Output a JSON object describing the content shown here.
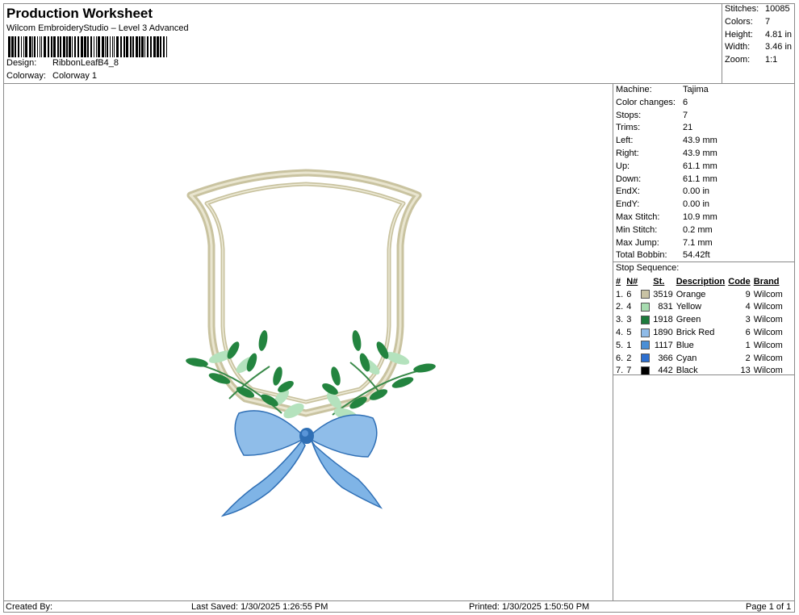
{
  "header": {
    "title": "Production Worksheet",
    "subtitle": "Wilcom EmbroideryStudio – Level 3 Advanced",
    "design_label": "Design:",
    "design_value": "RibbonLeafB4_8",
    "colorway_label": "Colorway:",
    "colorway_value": "Colorway 1"
  },
  "stats": [
    {
      "label": "Stitches:",
      "value": "10085"
    },
    {
      "label": "Colors:",
      "value": "7"
    },
    {
      "label": "Height:",
      "value": "4.81 in"
    },
    {
      "label": "Width:",
      "value": "3.46 in"
    },
    {
      "label": "Zoom:",
      "value": "1:1"
    }
  ],
  "machine": [
    {
      "label": "Machine:",
      "value": "Tajima"
    },
    {
      "label": "Color changes:",
      "value": "6"
    },
    {
      "label": "Stops:",
      "value": "7"
    },
    {
      "label": "Trims:",
      "value": "21"
    },
    {
      "label": "Left:",
      "value": "43.9 mm"
    },
    {
      "label": "Right:",
      "value": "43.9 mm"
    },
    {
      "label": "Up:",
      "value": "61.1 mm"
    },
    {
      "label": "Down:",
      "value": "61.1 mm"
    },
    {
      "label": "EndX:",
      "value": "0.00 in"
    },
    {
      "label": "EndY:",
      "value": "0.00 in"
    },
    {
      "label": "Max Stitch:",
      "value": "10.9 mm"
    },
    {
      "label": "Min Stitch:",
      "value": "0.2 mm"
    },
    {
      "label": "Max Jump:",
      "value": "7.1 mm"
    },
    {
      "label": "Total Bobbin:",
      "value": "54.42ft"
    }
  ],
  "stop_sequence": {
    "title": "Stop Sequence:",
    "columns": [
      "#",
      "N#",
      "St.",
      "Description",
      "Code",
      "Brand"
    ],
    "rows": [
      {
        "idx": "1.",
        "n": "6",
        "color": "#c8c2a4",
        "st": "3519",
        "desc": "Orange",
        "code": "9",
        "brand": "Wilcom"
      },
      {
        "idx": "2.",
        "n": "4",
        "color": "#a7dcb0",
        "st": "831",
        "desc": "Yellow",
        "code": "4",
        "brand": "Wilcom"
      },
      {
        "idx": "3.",
        "n": "3",
        "color": "#1d7a3c",
        "st": "1918",
        "desc": "Green",
        "code": "3",
        "brand": "Wilcom"
      },
      {
        "idx": "4.",
        "n": "5",
        "color": "#8fbbe8",
        "st": "1890",
        "desc": "Brick Red",
        "code": "6",
        "brand": "Wilcom"
      },
      {
        "idx": "5.",
        "n": "1",
        "color": "#4a8fd6",
        "st": "1117",
        "desc": "Blue",
        "code": "1",
        "brand": "Wilcom"
      },
      {
        "idx": "6.",
        "n": "2",
        "color": "#2d6fcf",
        "st": "366",
        "desc": "Cyan",
        "code": "2",
        "brand": "Wilcom"
      },
      {
        "idx": "7.",
        "n": "7",
        "color": "#000000",
        "st": "442",
        "desc": "Black",
        "code": "13",
        "brand": "Wilcom"
      }
    ]
  },
  "footer": {
    "created": "Created By:",
    "saved": "Last Saved: 1/30/2025 1:26:55 PM",
    "printed": "Printed: 1/30/2025 1:50:50 PM",
    "page": "Page 1 of 1"
  },
  "design_colors": {
    "frame": "#c9c3a0",
    "frame_light": "#e9e5cf",
    "leaf_dark": "#23843f",
    "leaf_light": "#b4e2bd",
    "ribbon": "#7fb4e6",
    "ribbon_dark": "#2f6fb5"
  }
}
